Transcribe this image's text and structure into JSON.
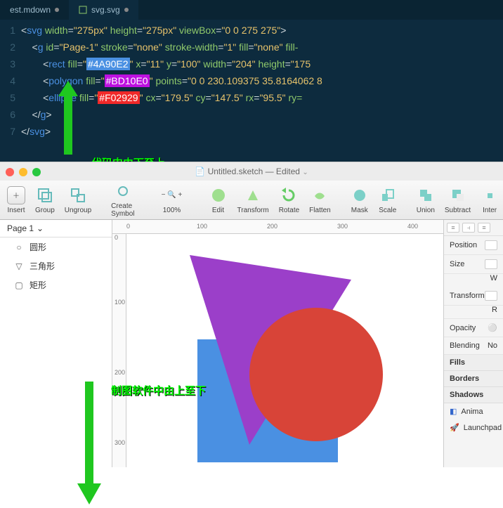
{
  "editor": {
    "tabs": [
      {
        "label": "est.mdown",
        "active": false
      },
      {
        "label": "svg.svg",
        "active": true
      }
    ],
    "code": {
      "l1a": "<",
      "l1b": "svg",
      "l1c": " width",
      "l1d": "=",
      "l1e": "\"275px\"",
      "l1f": " height",
      "l1g": "=",
      "l1h": "\"275px\"",
      "l1i": " viewBox",
      "l1j": "=",
      "l1k": "\"0 0 275 275\"",
      "l1l": ">",
      "l2a": "    <",
      "l2b": "g",
      "l2c": " id",
      "l2d": "=",
      "l2e": "\"Page-1\"",
      "l2f": " stroke",
      "l2g": "=",
      "l2h": "\"none\"",
      "l2i": " stroke-width",
      "l2j": "=",
      "l2k": "\"1\"",
      "l2l": " fill",
      "l2m": "=",
      "l2n": "\"none\"",
      "l2o": " fill-",
      "l3a": "        <",
      "l3b": "rect",
      "l3c": " fill",
      "l3d": "=",
      "l3e": "\"",
      "l3f": "#4A90E2",
      "l3g": "\"",
      "l3h": " x",
      "l3i": "=",
      "l3j": "\"11\"",
      "l3k": " y",
      "l3l": "=",
      "l3m": "\"100\"",
      "l3n": " width",
      "l3o": "=",
      "l3p": "\"204\"",
      "l3q": " height",
      "l3r": "=",
      "l3s": "\"175",
      "l4a": "        <",
      "l4b": "polygon",
      "l4c": " fill",
      "l4d": "=",
      "l4e": "\"",
      "l4f": "#BD10E0",
      "l4g": "\"",
      "l4h": " points",
      "l4i": "=",
      "l4j": "\"0 0 230.109375 35.8164062 8",
      "l5a": "        <",
      "l5b": "ellipse",
      "l5c": " fill",
      "l5d": "=",
      "l5e": "\"",
      "l5f": "#F02929",
      "l5g": "\"",
      "l5h": " cx",
      "l5i": "=",
      "l5j": "\"179.5\"",
      "l5k": " cy",
      "l5l": "=",
      "l5m": "\"147.5\"",
      "l5n": " rx",
      "l5o": "=",
      "l5p": "\"95.5\"",
      "l5q": " ry=",
      "l6a": "    </",
      "l6b": "g",
      "l6c": ">",
      "l7a": "</",
      "l7b": "svg",
      "l7c": ">"
    },
    "annotation": "代码中由下至上"
  },
  "sketch": {
    "title": "Untitled.sketch",
    "title_suffix": " — Edited",
    "toolbar": {
      "insert": "Insert",
      "group": "Group",
      "ungroup": "Ungroup",
      "create_symbol": "Create Symbol",
      "zoom": "100%",
      "edit": "Edit",
      "transform": "Transform",
      "rotate": "Rotate",
      "flatten": "Flatten",
      "mask": "Mask",
      "scale": "Scale",
      "union": "Union",
      "subtract": "Subtract",
      "intersect": "Inter"
    },
    "sidebar": {
      "page": "Page 1",
      "layers": [
        "圆形",
        "三角形",
        "矩形"
      ]
    },
    "ruler": {
      "m0": "0",
      "m100": "100",
      "m200": "200",
      "m300": "300",
      "m400": "400"
    },
    "inspector": {
      "position": "Position",
      "size": "Size",
      "w": "W",
      "transform": "Transform",
      "r": "R",
      "opacity": "Opacity",
      "blending": "Blending",
      "blend_val": "No",
      "fills": "Fills",
      "borders": "Borders",
      "shadows": "Shadows",
      "anima": "Anima",
      "launchpad": "Launchpad"
    },
    "annotation": "制图软件中由上至下"
  },
  "colors": {
    "rect": "#4A90E2",
    "tri": "#9b3fc9",
    "ellipse": "#d84438"
  }
}
